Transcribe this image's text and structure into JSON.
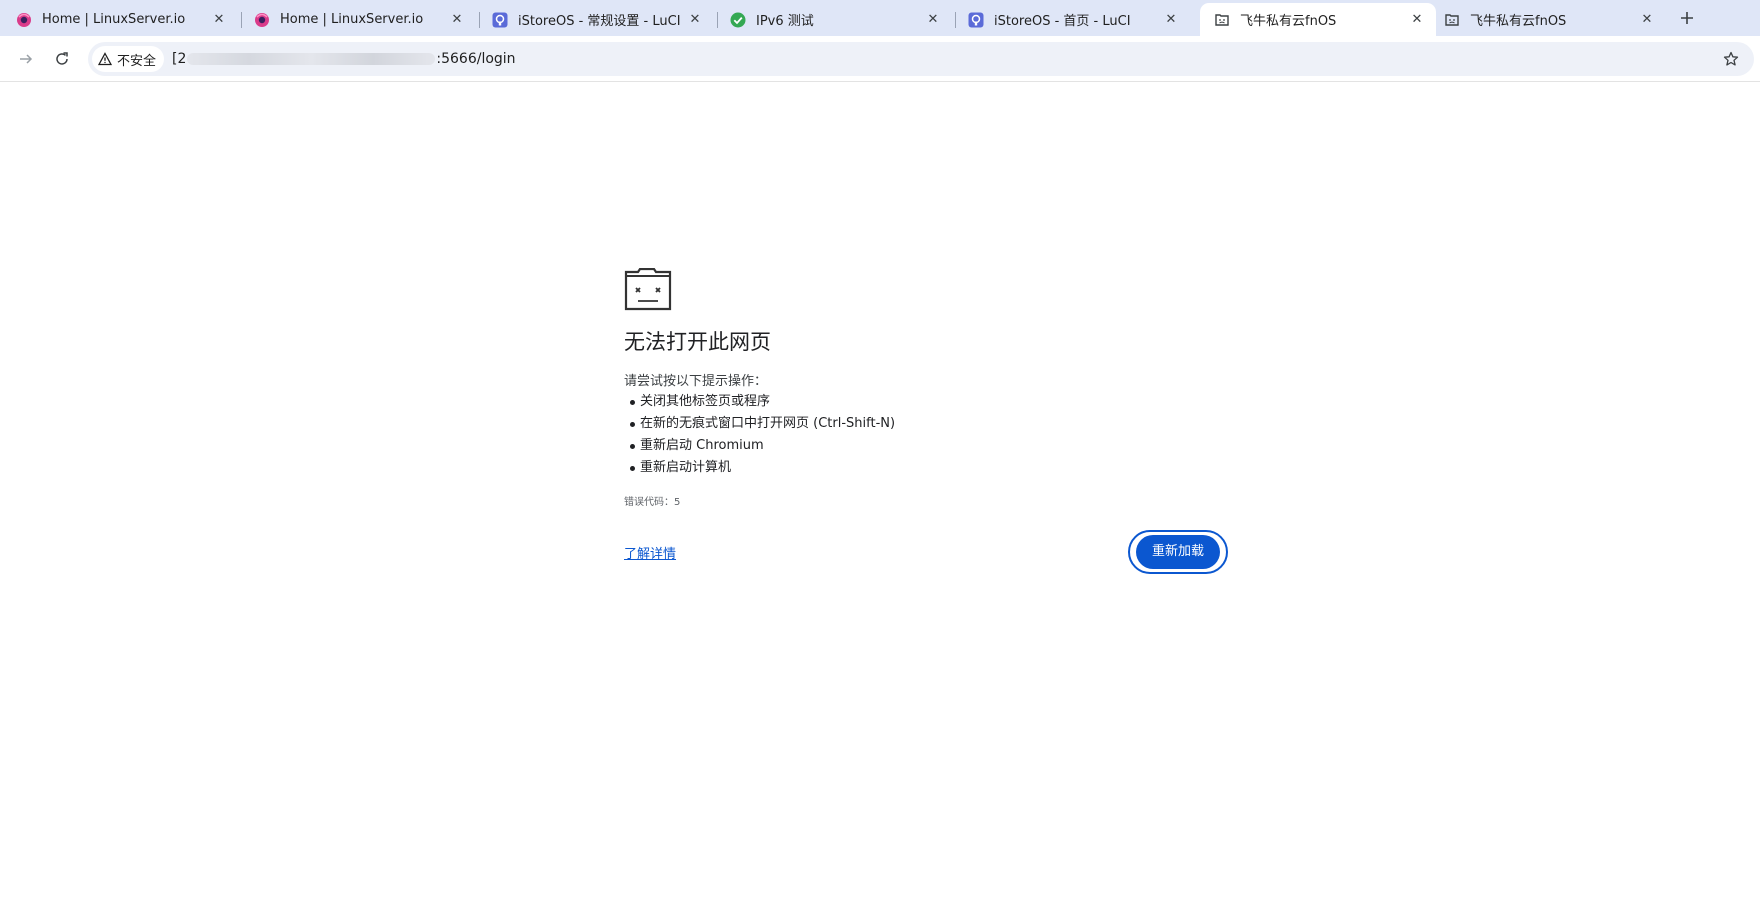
{
  "tabs": [
    {
      "title": "Home | LinuxServer.io",
      "icon": "linuxserver-logo-icon",
      "active": false
    },
    {
      "title": "Home | LinuxServer.io",
      "icon": "linuxserver-logo-icon",
      "active": false
    },
    {
      "title": "iStoreOS - 常规设置 - LuCI",
      "icon": "istoreos-logo-icon",
      "active": false
    },
    {
      "title": "IPv6 测试",
      "icon": "green-check-icon",
      "active": false
    },
    {
      "title": "iStoreOS - 首页 - LuCI",
      "icon": "istoreos-logo-icon",
      "active": false
    },
    {
      "title": "飞牛私有云fnOS",
      "icon": "sad-page-icon",
      "active": true
    },
    {
      "title": "飞牛私有云fnOS",
      "icon": "sad-page-icon",
      "active": false
    }
  ],
  "toolbar": {
    "security_label": "不安全",
    "url_prefix": "[2",
    "url_suffix": ":5666/login"
  },
  "error_page": {
    "title": "无法打开此网页",
    "suggestion_intro": "请尝试按以下提示操作：",
    "suggestions": [
      "关闭其他标签页或程序",
      "在新的无痕式窗口中打开网页 (Ctrl-Shift-N)",
      "重新启动 Chromium",
      "重新启动计算机"
    ],
    "error_code": "错误代码：5",
    "learn_more": "了解详情",
    "reload_label": "重新加载"
  },
  "colors": {
    "tabstrip_bg": "#dfe6f7",
    "omnibox_bg": "#eef1f8",
    "accent": "#0b57d0"
  }
}
